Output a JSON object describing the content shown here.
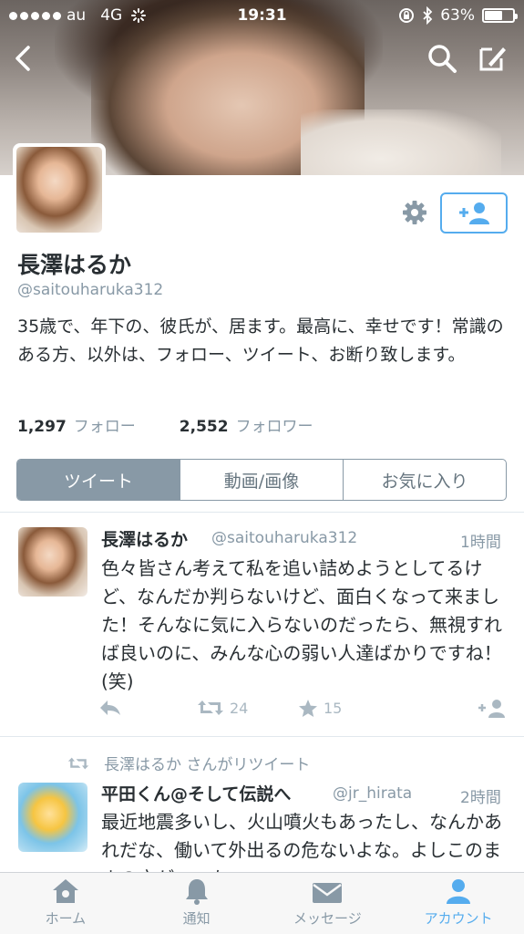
{
  "status_bar": {
    "carrier": "au",
    "network": "4G",
    "time": "19:31",
    "battery": "63%",
    "battery_level": 0.63
  },
  "profile": {
    "display_name": "長澤はるか",
    "handle": "@saitouharuka312",
    "bio": "35歳で、年下の、彼氏が、居ます。最高に、幸せです！常識のある方、以外は、フォロー、ツイート、お断り致します。",
    "following_count": "1,297",
    "following_label": "フォロー",
    "followers_count": "2,552",
    "followers_label": "フォロワー"
  },
  "tabs": [
    "ツイート",
    "動画/画像",
    "お気に入り"
  ],
  "tweets": [
    {
      "name": "長澤はるか",
      "handle": "@saitouharuka312",
      "time": "1時間",
      "text": "色々皆さん考えて私を追い詰めようとしてるけど、なんだか判らないけど、面白くなって来ました！そんなに気に入らないのだったら、無視すれば良いのに、みんな心の弱い人達ばかりですね！(笑)",
      "retweets": "24",
      "favorites": "15"
    },
    {
      "retweeted_by": "長澤はるか さんがリツイート",
      "name": "平田くん@そして伝説へ",
      "handle": "@jr_hirata",
      "time": "2時間",
      "text": "最近地震多いし、火山噴火もあったし、なんかあれだな、働いて外出るの危ないよな。よしこのままの方がいいな"
    }
  ],
  "tab_bar": [
    "ホーム",
    "通知",
    "メッセージ",
    "アカウント"
  ],
  "colors": {
    "accent": "#55acee",
    "muted": "#8899a6",
    "text": "#292f33"
  }
}
